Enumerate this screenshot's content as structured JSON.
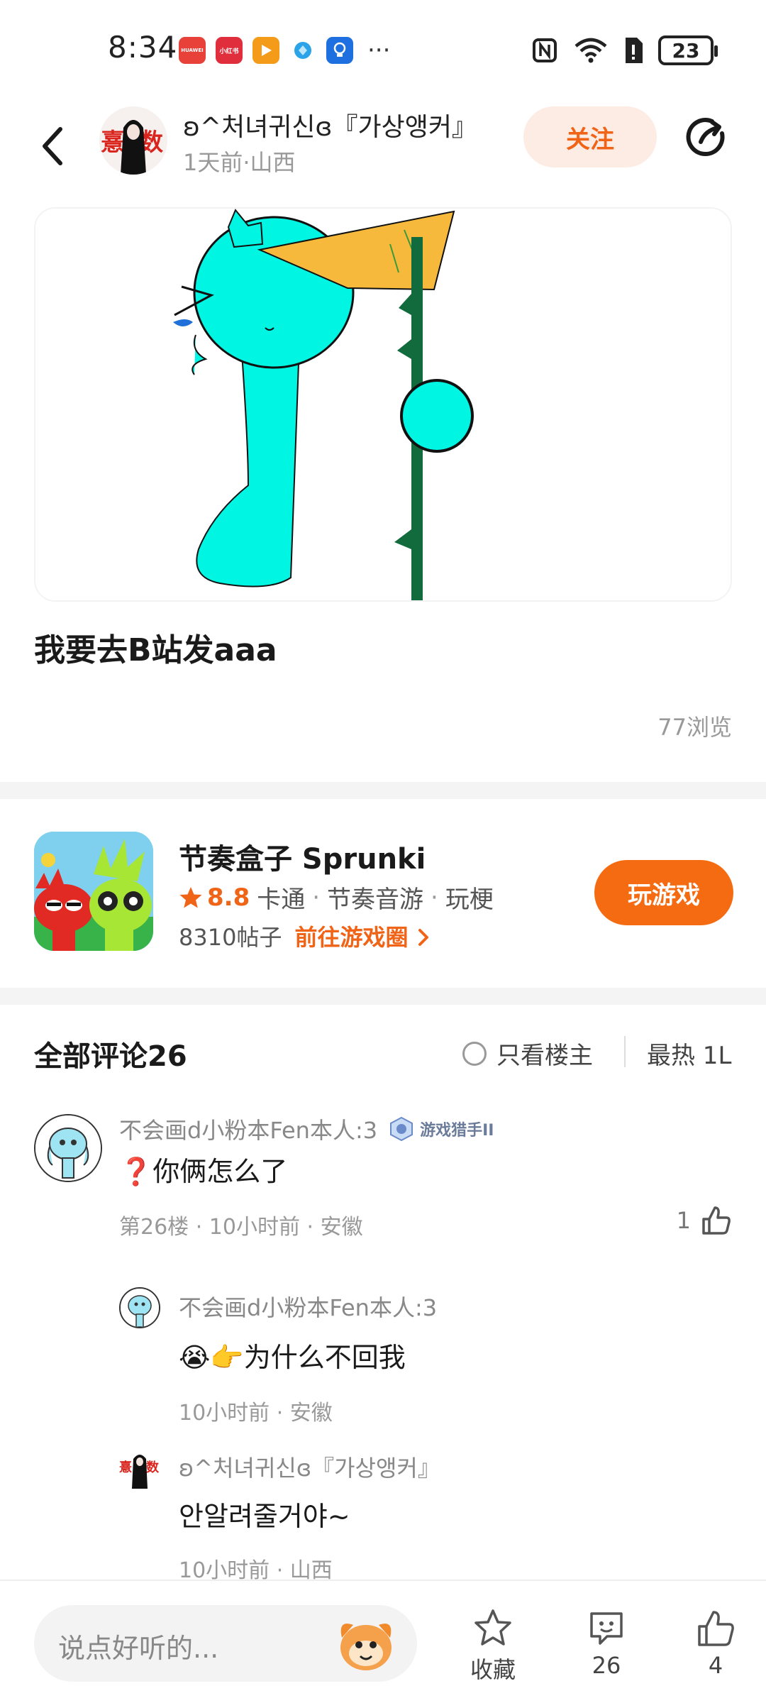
{
  "status_bar": {
    "time": "8:34",
    "apps": [
      {
        "name": "huawei-app",
        "color": "#e8413a",
        "label": "HUAWEI"
      },
      {
        "name": "xiaohongshu-app",
        "color": "#e02e3c",
        "label": "小红书"
      },
      {
        "name": "video-app",
        "color": "#f59b1a",
        "label": ""
      },
      {
        "name": "browser-app",
        "color": "#2aa3e8",
        "label": ""
      },
      {
        "name": "bulb-app",
        "color": "#1e6fe0",
        "label": ""
      }
    ],
    "more": "···",
    "battery": "23"
  },
  "header": {
    "author_name": "ʚ^처녀귀신ɞ『가상앵커』",
    "author_meta": "1天前·山西",
    "follow_label": "关注"
  },
  "post": {
    "title": "我要去B站发aaa",
    "views": "77浏览"
  },
  "game": {
    "name": "节奏盒子 Sprunki",
    "rating": "8.8",
    "tags": [
      "卡通",
      "节奏音游",
      "玩梗"
    ],
    "posts": "8310帖子",
    "link_label": "前往游戏圈",
    "play_label": "玩游戏"
  },
  "comments_header": {
    "title": "全部评论26",
    "only_op": "只看楼主",
    "sort": "最热 1L"
  },
  "comments": [
    {
      "author": "不会画d小粉本Fen本人:3",
      "badge": "游戏猎手II",
      "text": "❓你俩怎么了",
      "meta": "第26楼 · 10小时前 · 安徽",
      "likes": "1"
    }
  ],
  "replies": [
    {
      "author": "不会画d小粉本Fen本人:3",
      "text": "😭👉为什么不回我",
      "meta": "10小时前 · 安徽"
    },
    {
      "author": "ʚ^처녀귀신ɞ『가상앵커』",
      "text": "안알려줄거야~",
      "meta": "10小时前 · 山西"
    }
  ],
  "bottom_bar": {
    "input_placeholder": "说点好听的...",
    "favorite_label": "收藏",
    "comment_count": "26",
    "like_count": "4"
  },
  "colors": {
    "accent": "#f06418",
    "play_button": "#f56b12",
    "follow_bg": "#fdece3"
  }
}
